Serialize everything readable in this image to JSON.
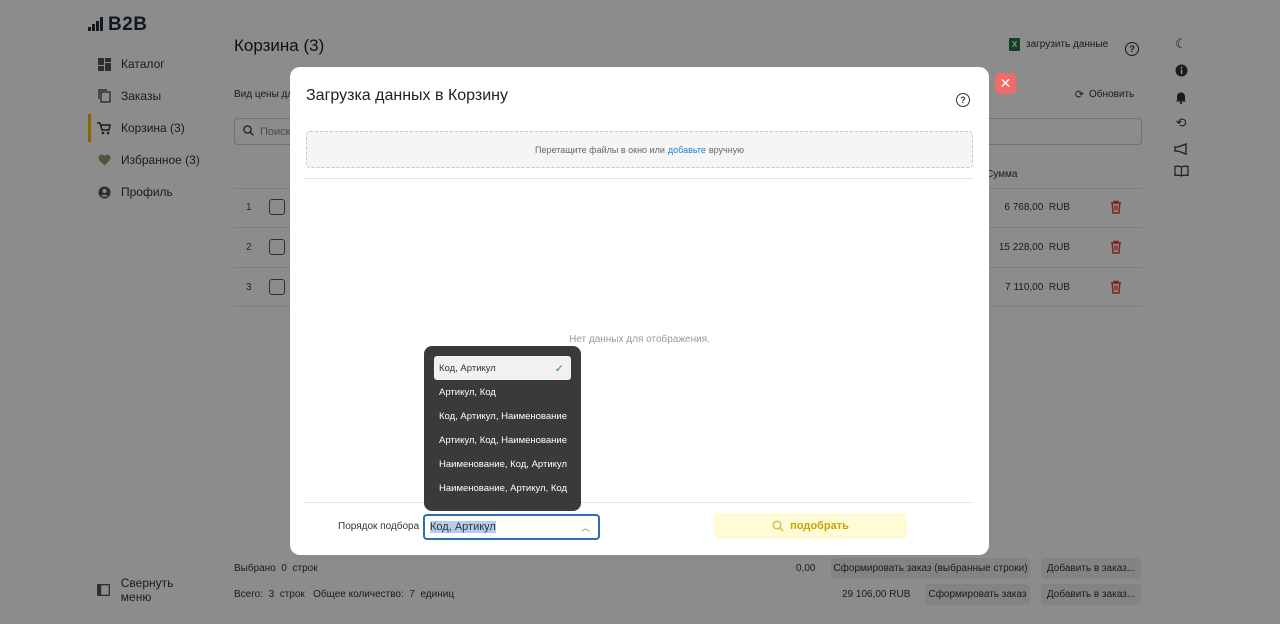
{
  "app": {
    "logo": "B2B"
  },
  "sidebar": {
    "items": [
      {
        "label": "Каталог",
        "icon": "grid-icon"
      },
      {
        "label": "Заказы",
        "icon": "copy-icon"
      },
      {
        "label": "Корзина (3)",
        "icon": "cart-icon",
        "active": true
      },
      {
        "label": "Избранное (3)",
        "icon": "heart-icon"
      },
      {
        "label": "Профиль",
        "icon": "user-icon"
      }
    ],
    "collapse_label": "Свернуть меню"
  },
  "header": {
    "title": "Корзина (3)",
    "upload_label": "загрузить данные",
    "price_label": "Вид цены для",
    "refresh_label": "Обновить",
    "search_placeholder": "Поиск"
  },
  "table": {
    "sum_header": "Сумма",
    "rows": [
      {
        "num": "1",
        "sum": "6 768,00",
        "currency": "RUB"
      },
      {
        "num": "2",
        "sum": "15 228,00",
        "currency": "RUB"
      },
      {
        "num": "3",
        "sum": "7 110,00",
        "currency": "RUB"
      }
    ]
  },
  "footer": {
    "selected_label": "Выбрано",
    "selected_count": "0",
    "rows_word": "строк",
    "selected_sum": "0,00",
    "form_selected_btn": "Сформировать заказ (выбранные строки)",
    "add_to_order_btn": "Добавить в заказ...",
    "total_label": "Всего:",
    "total_count": "3",
    "total_qty_label": "Общее количество:",
    "total_qty": "7",
    "units_word": "единиц",
    "total_sum": "29 106,00 RUB",
    "form_order_btn": "Сформировать заказ",
    "add_to_order_btn2": "Добавить в заказ..."
  },
  "modal": {
    "title": "Загрузка данных в Корзину",
    "drop_text_before": "Перетащите файлы в окно или",
    "drop_link": "добавьте",
    "drop_text_after": "вручную",
    "no_data": "Нет данных для отображения.",
    "order_label": "Порядок подбора",
    "order_value": "Код, Артикул",
    "pick_button": "подобрать"
  },
  "dropdown": {
    "options": [
      "Код, Артикул",
      "Артикул, Код",
      "Код, Артикул, Наименование",
      "Артикул, Код, Наименование",
      "Наименование, Код, Артикул",
      "Наименование, Артикул, Код"
    ],
    "selected_index": 0
  },
  "colors": {
    "accent": "#f6b800",
    "link": "#1b7fd6",
    "danger": "#e53935",
    "select_border": "#2a6fb5"
  }
}
